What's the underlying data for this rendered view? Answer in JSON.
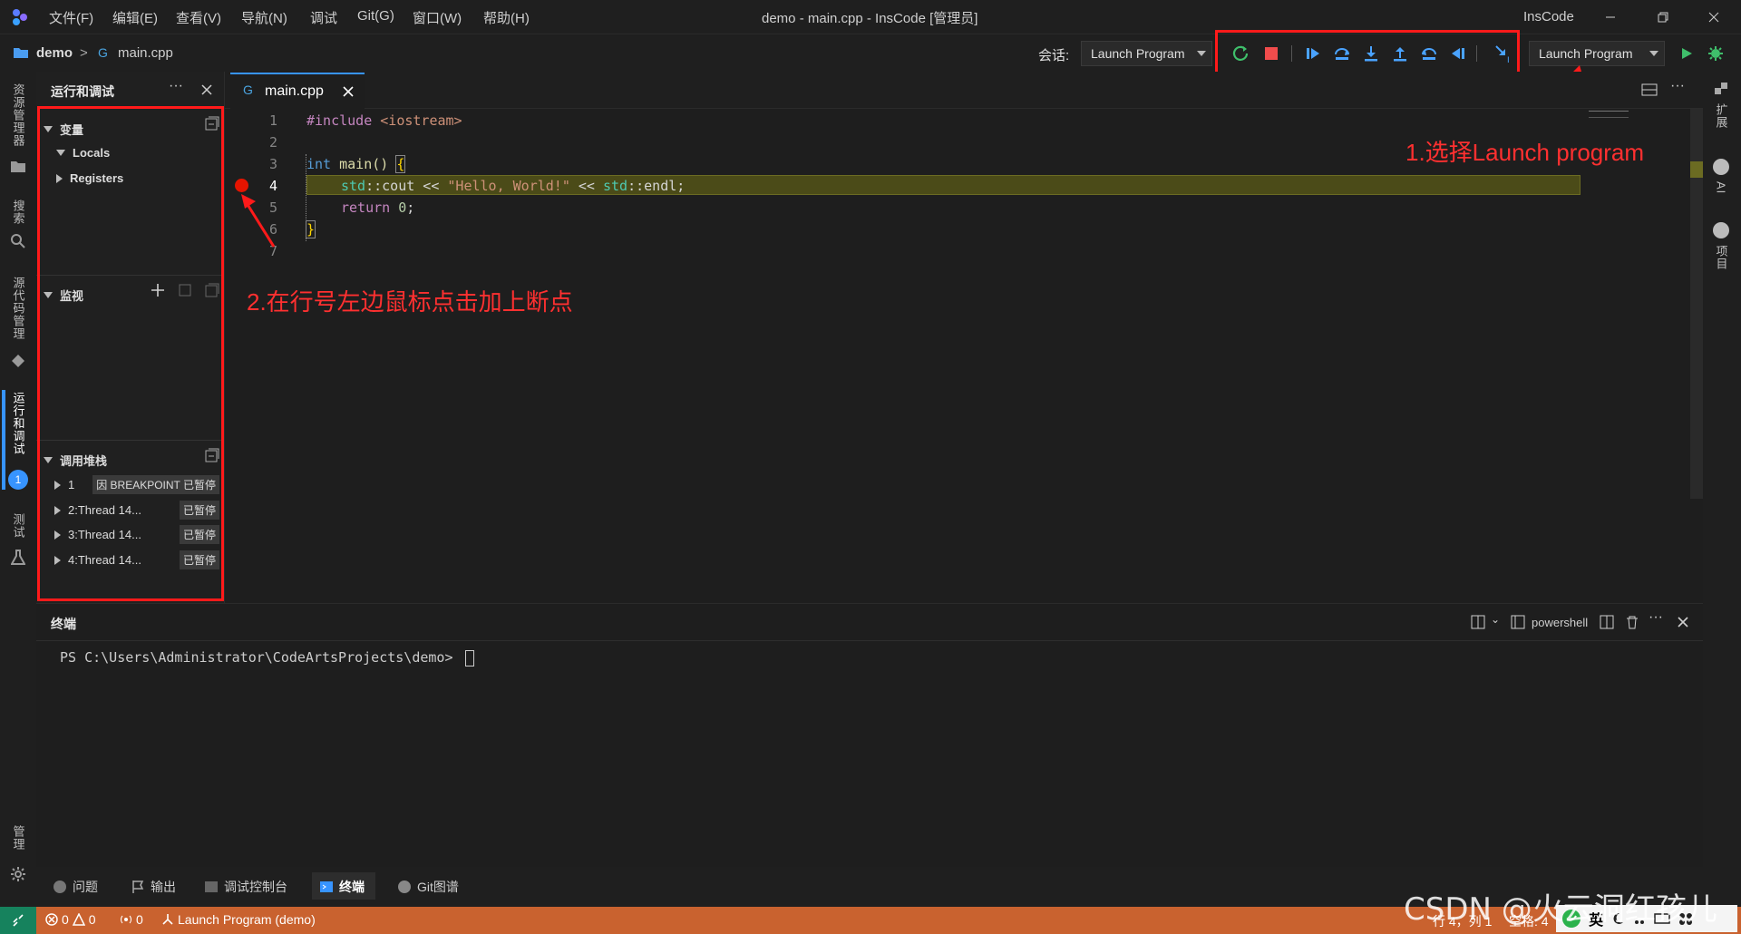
{
  "titlebar": {
    "menus": [
      "文件(F)",
      "编辑(E)",
      "查看(V)",
      "导航(N)",
      "调试",
      "Git(G)",
      "窗口(W)",
      "帮助(H)"
    ],
    "window_title": "demo - main.cpp - InsCode [管理员]",
    "brand": "InsCode"
  },
  "breadcrumb": {
    "project": "demo",
    "separator": ">",
    "file": "main.cpp"
  },
  "toolbar": {
    "session_label": "会话:",
    "session_value": "Launch Program",
    "launch_config": "Launch Program"
  },
  "activitybar": {
    "items": [
      "资源管理器",
      "搜索",
      "源代码管理",
      "运行和调试",
      "测试",
      "管理"
    ],
    "debug_badge": "1"
  },
  "rightbar": {
    "items": [
      "扩展",
      "AI",
      "项目"
    ]
  },
  "sidebar": {
    "title": "运行和调试",
    "variables": {
      "title": "变量",
      "locals": "Locals",
      "registers": "Registers"
    },
    "watch": {
      "title": "监视"
    },
    "callstack": {
      "title": "调用堆栈",
      "threads": [
        {
          "label": "1",
          "detail": "因 BREAKPOINT 已暂停"
        },
        {
          "label": "2:Thread 14...",
          "detail": "已暂停"
        },
        {
          "label": "3:Thread 14...",
          "detail": "已暂停"
        },
        {
          "label": "4:Thread 14...",
          "detail": "已暂停"
        }
      ]
    }
  },
  "editor": {
    "tab": "main.cpp",
    "line_numbers": [
      "1",
      "2",
      "3",
      "4",
      "5",
      "6",
      "7"
    ],
    "code": {
      "l1a": "#include ",
      "l1b": "<iostream>",
      "l3a": "int",
      "l3b": " main() ",
      "l3c": "{",
      "l4a": "std",
      "l4b": "::cout << ",
      "l4c": "\"Hello, World!\"",
      "l4d": " << ",
      "l4e": "std",
      "l4f": "::endl;",
      "l5a": "return ",
      "l5b": "0",
      "l5c": ";",
      "l6": "}"
    },
    "current_line": 4,
    "breakpoint_line": 4
  },
  "annotations": {
    "step1": "1.选择Launch program",
    "step2": "2.在行号左边鼠标点击加上断点"
  },
  "panel": {
    "title": "终端",
    "shell": "powershell",
    "prompt": "PS C:\\Users\\Administrator\\CodeArtsProjects\\demo> "
  },
  "bottom_tabs": [
    "问题",
    "输出",
    "调试控制台",
    "终端",
    "Git图谱"
  ],
  "statusbar": {
    "errors": "0",
    "warnings": "0",
    "ports": "0",
    "launch": "Launch Program (demo)",
    "position": "行 4，列 1",
    "spaces": "空格: 4",
    "ime": "英"
  },
  "watermark": "CSDN @火云洞红孩儿",
  "colors": {
    "status_bar": "#c9622f",
    "accent": "#3794ff",
    "breakpoint": "#e51400",
    "annotation": "#ff1a1a"
  }
}
